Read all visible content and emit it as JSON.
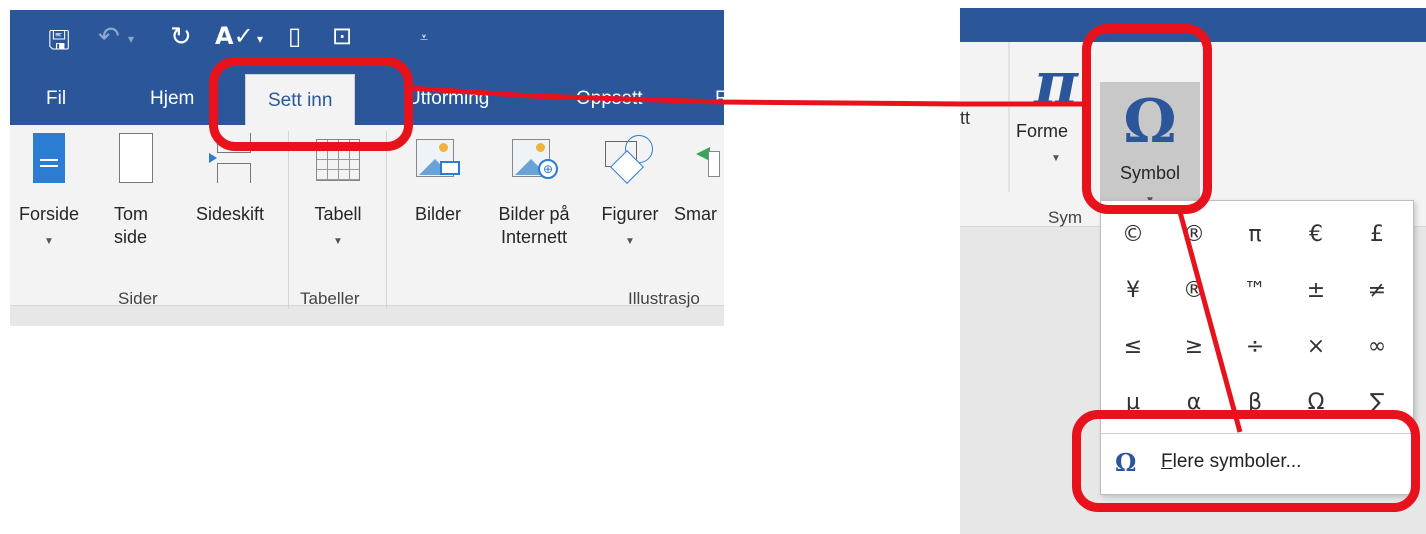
{
  "left_panel": {
    "qat_icons": [
      "save-icon",
      "undo-icon",
      "redo-icon",
      "spelling-icon",
      "new-document-icon",
      "print-preview-icon",
      "customize-qat-icon"
    ],
    "tabs": {
      "file": "Fil",
      "home": "Hjem",
      "insert": "Sett inn",
      "design": "Utforming",
      "layout": "Oppsett",
      "partial": "R"
    },
    "ribbon": {
      "cover_page": "Forside",
      "blank_page": "Tom side",
      "page_break": "Sideskift",
      "table": "Tabell",
      "pictures": "Bilder",
      "online_pictures": "Bilder på Internett",
      "shapes": "Figurer",
      "smartart": "Smar"
    },
    "groups": {
      "pages": "Sider",
      "tables": "Tabeller",
      "illustrations": "Illustrasjo"
    }
  },
  "right_panel": {
    "partial_left": "tt",
    "equation_glyph": "π",
    "equation_label": "Forme",
    "symbol_glyph": "Ω",
    "symbol_label": "Symbol",
    "group_label": "Sym",
    "symbols": [
      [
        "©",
        "®",
        "π",
        "€",
        "£"
      ],
      [
        "¥",
        "®",
        "™",
        "±",
        "≠"
      ],
      [
        "≤",
        "≥",
        "÷",
        "×",
        "∞"
      ],
      [
        "µ",
        "α",
        "β",
        "Ω",
        "∑"
      ]
    ],
    "more_symbols_glyph": "Ω",
    "more_symbols_access": "F",
    "more_symbols_rest": "lere symboler..."
  },
  "colors": {
    "ribbon_blue": "#2b579a",
    "annotation_red": "#e8121d"
  }
}
